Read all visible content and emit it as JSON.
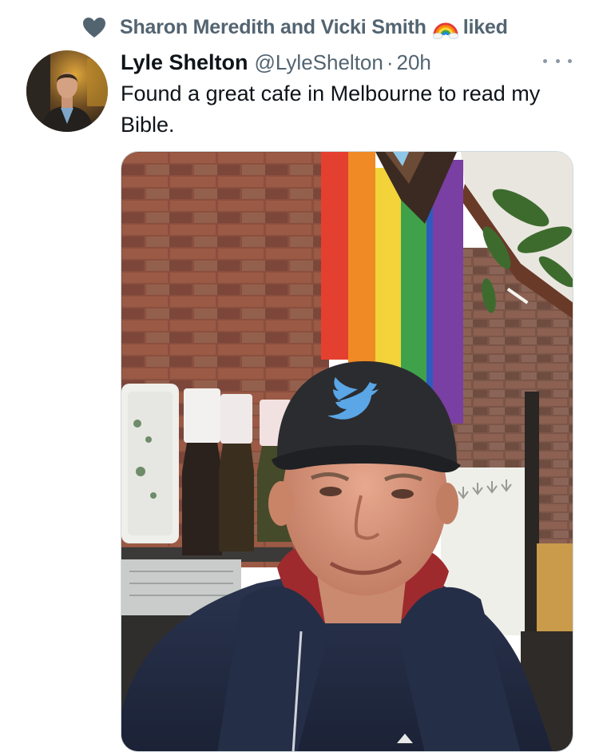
{
  "social_context": {
    "icon": "heart-icon",
    "text_before": "Sharon Meredith and Vicki Smith",
    "emoji": "rainbow-icon",
    "text_after": "liked"
  },
  "author": {
    "display_name": "Lyle Shelton",
    "handle": "@LyleShelton",
    "separator": "·",
    "timestamp": "20h",
    "avatar": "profile-painting-avatar"
  },
  "tweet": {
    "text": "Found a great cafe in Melbourne to read my Bible.",
    "more_icon": "more-dots-icon"
  },
  "media": {
    "photo": "selfie in cafe with brick wall, progress pride flag, man wearing cap with bird logo",
    "cap_logo": "bird-logo-icon"
  },
  "colors": {
    "primary_text": "#0f1419",
    "secondary_text": "#536471",
    "heart": "#536471",
    "border": "#cfd9de"
  }
}
